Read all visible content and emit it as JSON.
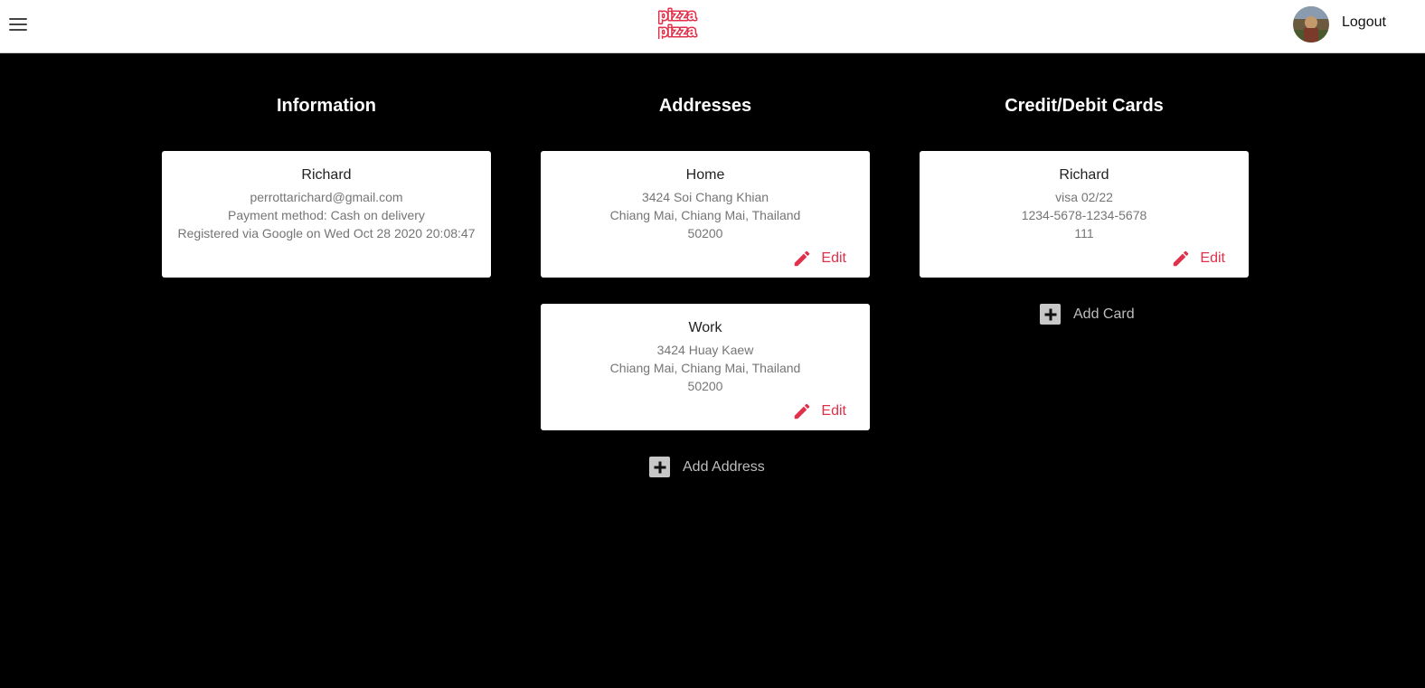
{
  "header": {
    "menu_icon": "hamburger-menu-icon",
    "logo_text": [
      "pizza",
      "pizza"
    ],
    "logout_label": "Logout",
    "brand_color": "#e0304a"
  },
  "information": {
    "title": "Information",
    "name": "Richard",
    "email": "perrottarichard@gmail.com",
    "payment": "Payment method: Cash on delivery",
    "registered": "Registered via Google on Wed Oct 28 2020 20:08:47"
  },
  "addresses": {
    "title": "Addresses",
    "items": [
      {
        "label": "Home",
        "street": "3424 Soi Chang Khian",
        "city": "Chiang Mai, Chiang Mai, Thailand",
        "zip": "50200",
        "edit_label": "Edit"
      },
      {
        "label": "Work",
        "street": "3424 Huay Kaew",
        "city": "Chiang Mai, Chiang Mai, Thailand",
        "zip": "50200",
        "edit_label": "Edit"
      }
    ],
    "add_label": "Add Address"
  },
  "cards": {
    "title": "Credit/Debit Cards",
    "items": [
      {
        "name": "Richard",
        "type_exp": "visa 02/22",
        "number": "1234-5678-1234-5678",
        "cvv": "111",
        "edit_label": "Edit"
      }
    ],
    "add_label": "Add Card"
  }
}
